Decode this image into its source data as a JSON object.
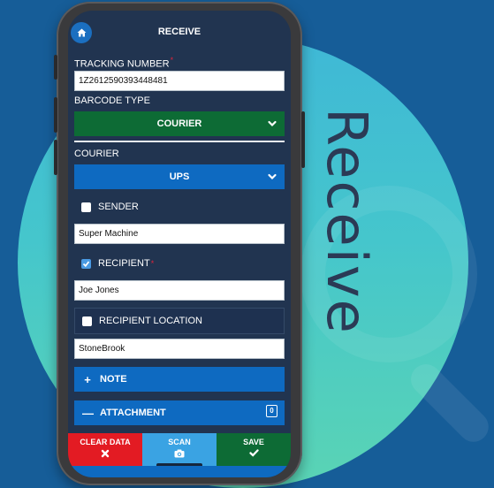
{
  "background": {
    "headline": "Receive",
    "colors": {
      "page": "#165d98",
      "circle_top": "#3fb8d6",
      "circle_bottom": "#5ad4b4",
      "headline": "#2b3a55"
    }
  },
  "app": {
    "title": "RECEIVE",
    "home_icon": "home-icon",
    "form": {
      "tracking_number": {
        "label": "TRACKING NUMBER",
        "required": true,
        "required_mark": "*",
        "value": "1Z2612590393448481"
      },
      "barcode_type": {
        "label": "BARCODE TYPE",
        "selected": "COURIER",
        "color": "#0d6b35"
      },
      "courier": {
        "label": "COURIER",
        "selected": "UPS",
        "color": "#0e6ac1"
      },
      "sender": {
        "label": "SENDER",
        "checked": false,
        "value": "Super Machine"
      },
      "recipient": {
        "label": "RECIPIENT",
        "required": true,
        "required_mark": "*",
        "checked": true,
        "value": "Joe  Jones"
      },
      "recipient_location": {
        "label": "RECIPIENT LOCATION",
        "checked": false,
        "value": "StoneBrook"
      },
      "note": {
        "label": "NOTE",
        "icon": "plus-icon"
      },
      "attachment": {
        "label": "ATTACHMENT",
        "icon": "minus-icon",
        "count": "0"
      }
    },
    "actions": {
      "clear": {
        "label": "CLEAR DATA",
        "icon": "x-icon",
        "color": "#e31b23"
      },
      "scan": {
        "label": "SCAN",
        "icon": "camera-icon",
        "color": "#3aa3e3"
      },
      "save": {
        "label": "SAVE",
        "icon": "check-icon",
        "color": "#0d6b35"
      }
    }
  }
}
